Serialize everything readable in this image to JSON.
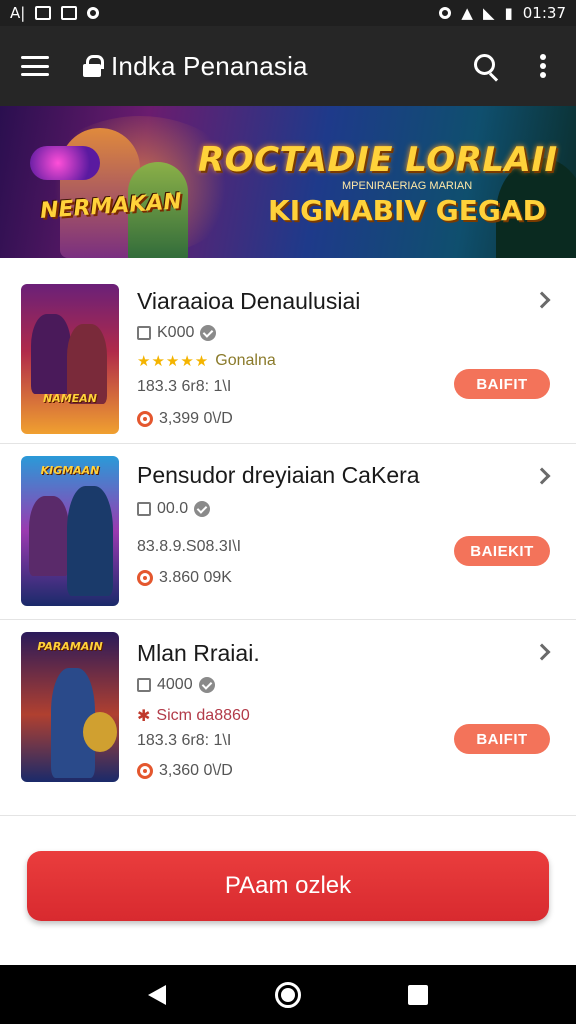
{
  "status_bar": {
    "left_text": "A|",
    "time": "01:37"
  },
  "app_bar": {
    "title": "Indka Penanasia"
  },
  "banner": {
    "logo_text": "NERMAKAN",
    "title": "ROCTADIE LORLAII",
    "tagline": "MPENIRAERIAG MARIAN",
    "subtitle": "KIGMABIV GEGAD"
  },
  "items": [
    {
      "title": "Viaraaioa Denaulusiai",
      "count": "K000",
      "rating_stars": "★★★★★",
      "genre": "Gonalna",
      "stats": "183.3 6r8: 1\\I",
      "views": "3,399 0\\/D",
      "badge": "BAIFIT",
      "poster_label": "NAMEAN"
    },
    {
      "title": "Pensudor dreyiaian CaKera",
      "count": "00.0",
      "stats": "83.8.9.S08.3I\\I",
      "views": "3.860 09K",
      "badge": "BAIEKIT",
      "poster_label": "KIGMAAN"
    },
    {
      "title": "Mlan Rraiai.",
      "count": "4000",
      "rank_text": "Sicm da8860",
      "stats": "183.3 6r8: 1\\I",
      "views": "3,360 0\\/D",
      "badge": "BAIFIT",
      "poster_label": "PARAMAIN"
    }
  ],
  "cta": {
    "label": "PAam ozlek"
  },
  "colors": {
    "accent": "#e53935",
    "badge": "#f3735a",
    "appbar": "#262626"
  },
  "icons": {
    "menu": "hamburger-icon",
    "lock": "lock-icon",
    "search": "search-icon",
    "more": "more-vert-icon"
  }
}
